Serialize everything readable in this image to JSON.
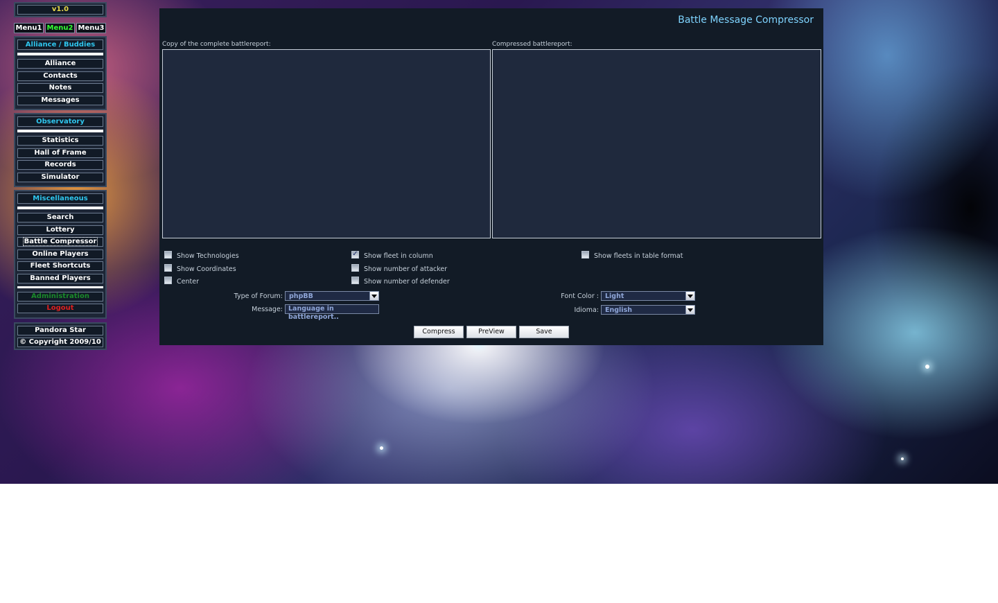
{
  "version": "v1.0",
  "menu_tabs": [
    {
      "label": "Menu1",
      "active": false
    },
    {
      "label": "Menu2",
      "active": true
    },
    {
      "label": "Menu3",
      "active": false
    }
  ],
  "sections": {
    "alliance": {
      "header": "Alliance / Buddies",
      "items": [
        "Alliance",
        "Contacts",
        "Notes",
        "Messages"
      ]
    },
    "observatory": {
      "header": "Observatory",
      "items": [
        "Statistics",
        "Hall of Frame",
        "Records",
        "Simulator"
      ]
    },
    "misc": {
      "header": "Miscellaneous",
      "items": [
        "Search",
        "Lottery",
        "Battle Compressor",
        "Online Players",
        "Fleet Shortcuts",
        "Banned Players"
      ],
      "selected": "Battle Compressor",
      "admin": "Administration",
      "logout": "Logout"
    }
  },
  "footer": {
    "name": "Pandora Star",
    "copyright": "© Copyright 2009/10"
  },
  "main": {
    "title": "Battle Message Compressor",
    "input_label": "Copy of the complete battlereport:",
    "output_label": "Compressed battlereport:",
    "options": {
      "show_technologies": {
        "label": "Show Technologies",
        "checked": false
      },
      "show_coordinates": {
        "label": "Show Coordinates",
        "checked": false
      },
      "center": {
        "label": "Center",
        "checked": false
      },
      "show_fleet_in_column": {
        "label": "Show fleet in column",
        "checked": true
      },
      "show_number_attacker": {
        "label": "Show number of attacker",
        "checked": false
      },
      "show_number_defender": {
        "label": "Show number of defender",
        "checked": false
      },
      "show_fleets_table": {
        "label": "Show fleets in table format",
        "checked": false
      }
    },
    "forum_type": {
      "label": "Type of Forum:",
      "value": "phpBB"
    },
    "message": {
      "label": "Message:",
      "value": "Language in battlereport.."
    },
    "font_color": {
      "label": "Font Color :",
      "value": "Light"
    },
    "idioma": {
      "label": "Idioma:",
      "value": "English"
    },
    "buttons": {
      "compress": "Compress",
      "preview": "PreView",
      "save": "Save"
    }
  }
}
